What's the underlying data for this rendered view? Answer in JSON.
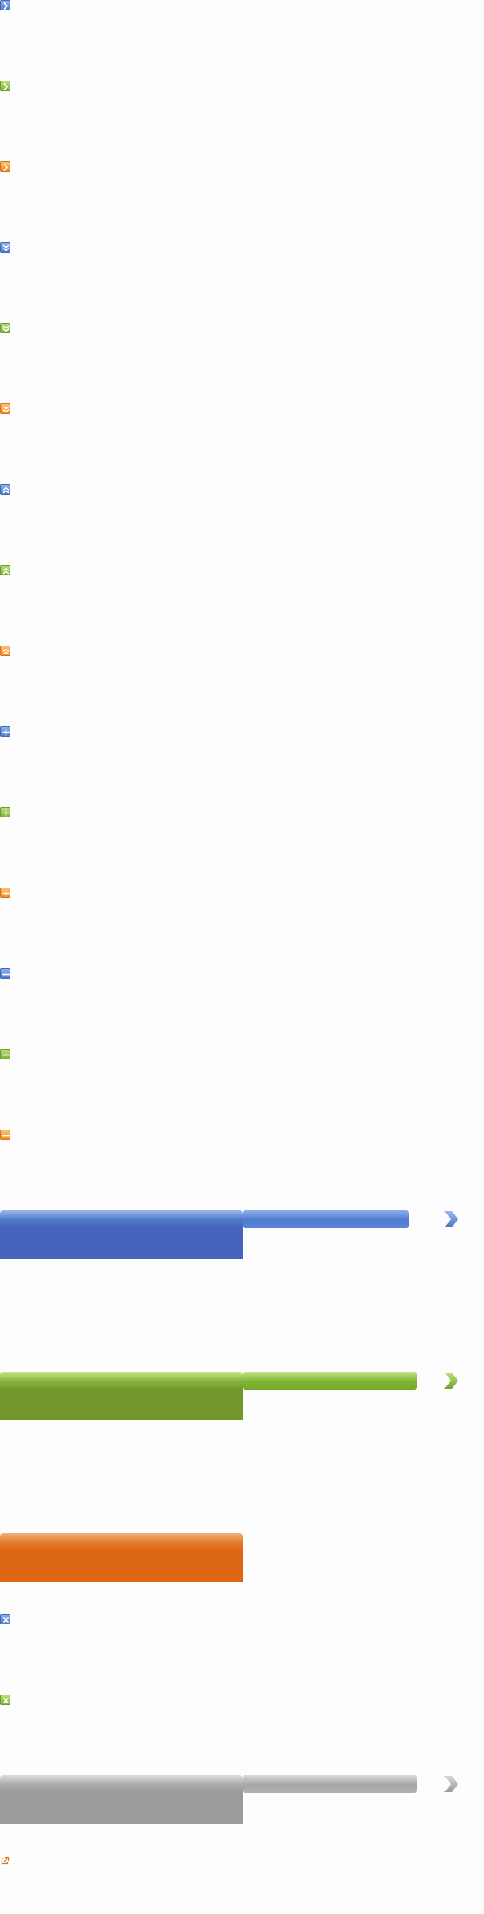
{
  "colors": {
    "blue": "#4563bd",
    "green": "#72982c",
    "orange": "#de6715",
    "gray": "#9b9b9b"
  },
  "sprites": {
    "small_icons": [
      {
        "color": "blue",
        "glyph": "arrow-right-icon"
      },
      {
        "color": "green",
        "glyph": "arrow-right-icon"
      },
      {
        "color": "orange",
        "glyph": "arrow-right-icon"
      },
      {
        "color": "blue",
        "glyph": "double-chevron-down-icon"
      },
      {
        "color": "green",
        "glyph": "double-chevron-down-icon"
      },
      {
        "color": "orange",
        "glyph": "double-chevron-down-icon"
      },
      {
        "color": "blue",
        "glyph": "double-chevron-up-icon"
      },
      {
        "color": "green",
        "glyph": "double-chevron-up-icon"
      },
      {
        "color": "orange",
        "glyph": "double-chevron-up-icon"
      },
      {
        "color": "blue",
        "glyph": "plus-icon"
      },
      {
        "color": "green",
        "glyph": "plus-icon"
      },
      {
        "color": "orange",
        "glyph": "plus-icon"
      },
      {
        "color": "blue",
        "glyph": "minus-icon"
      },
      {
        "color": "green",
        "glyph": "minus-icon"
      },
      {
        "color": "orange",
        "glyph": "minus-icon"
      }
    ],
    "bars": [
      {
        "color": "blue",
        "has_slim_bar": true,
        "has_chevron": true
      },
      {
        "color": "green",
        "has_slim_bar": true,
        "has_chevron": true
      },
      {
        "color": "orange",
        "has_slim_bar": false,
        "has_chevron": false
      }
    ],
    "close_icons": [
      {
        "color": "blue",
        "glyph": "close-icon"
      },
      {
        "color": "green",
        "glyph": "close-icon"
      }
    ],
    "gray_bar": {
      "color": "gray",
      "has_slim_bar": true,
      "has_chevron": true
    },
    "external_link_icon": {
      "color": "orange",
      "glyph": "external-link-icon"
    }
  }
}
